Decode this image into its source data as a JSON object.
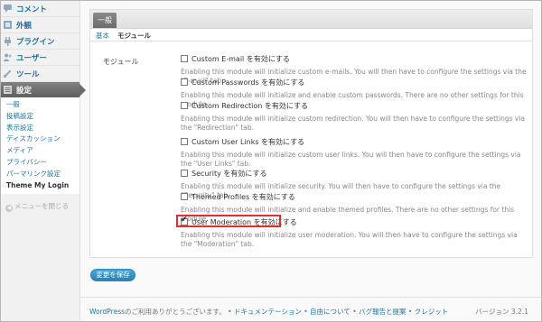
{
  "sidebar": {
    "items": [
      {
        "label": "コメント",
        "icon": "comment-icon"
      },
      {
        "label": "外観",
        "icon": "appearance-icon"
      },
      {
        "label": "プラグイン",
        "icon": "plugin-icon"
      },
      {
        "label": "ユーザー",
        "icon": "users-icon"
      },
      {
        "label": "ツール",
        "icon": "tools-icon"
      },
      {
        "label": "設定",
        "icon": "settings-icon",
        "active": true
      }
    ],
    "submenu": [
      "一般",
      "投稿設定",
      "表示設定",
      "ディスカッション",
      "メディア",
      "プライバシー",
      "パーマリンク設定",
      "Theme My Login"
    ],
    "collapse_label": "メニューを閉じる"
  },
  "panel": {
    "tab": "一般",
    "subtabs": {
      "basic": "基本",
      "modules": "モジュール"
    }
  },
  "section_label": "モジュール",
  "modules": [
    {
      "label": "Custom E-mail を有効にする",
      "checked": false,
      "desc": "Enabling this module will initialize custom e-mails. You will then have to configure the settings via the \"E-mail\" tab."
    },
    {
      "label": "Custom Passwords を有効にする",
      "checked": false,
      "desc": "Enabling this module will initialize and enable custom passwords. There are no other settings for this module."
    },
    {
      "label": "Custom Redirection を有効にする",
      "checked": false,
      "desc": "Enabling this module will initialize custom redirection. You will then have to configure the settings via the \"Redirection\" tab."
    },
    {
      "label": "Custom User Links を有効にする",
      "checked": false,
      "desc": "Enabling this module will initialize custom user links. You will then have to configure the settings via the \"User Links\" tab."
    },
    {
      "label": "Security を有効にする",
      "checked": false,
      "desc": "Enabling this module will initialize security. You will then have to configure the settings via the \"Security\" tab."
    },
    {
      "label": "Themed Profiles を有効にする",
      "checked": false,
      "desc": "Enabling this module will initialize and enable themed profiles. There are no other settings for this module."
    },
    {
      "label": "User Moderation を有効にする",
      "checked": true,
      "desc": "Enabling this module will initialize user moderation. You will then have to configure the settings via the \"Moderation\" tab."
    }
  ],
  "save_button": "変更を保存",
  "footer": {
    "links": [
      "WordPress",
      "ドキュメンテーション",
      "自由について",
      "バグ報告と提案",
      "クレジット"
    ],
    "thanks": "のご利用ありがとうございます。",
    "version": "バージョン 3.2.1"
  },
  "colors": {
    "link": "#21759b",
    "highlight": "#e0302b",
    "active_menu": "#6a6a6a"
  }
}
